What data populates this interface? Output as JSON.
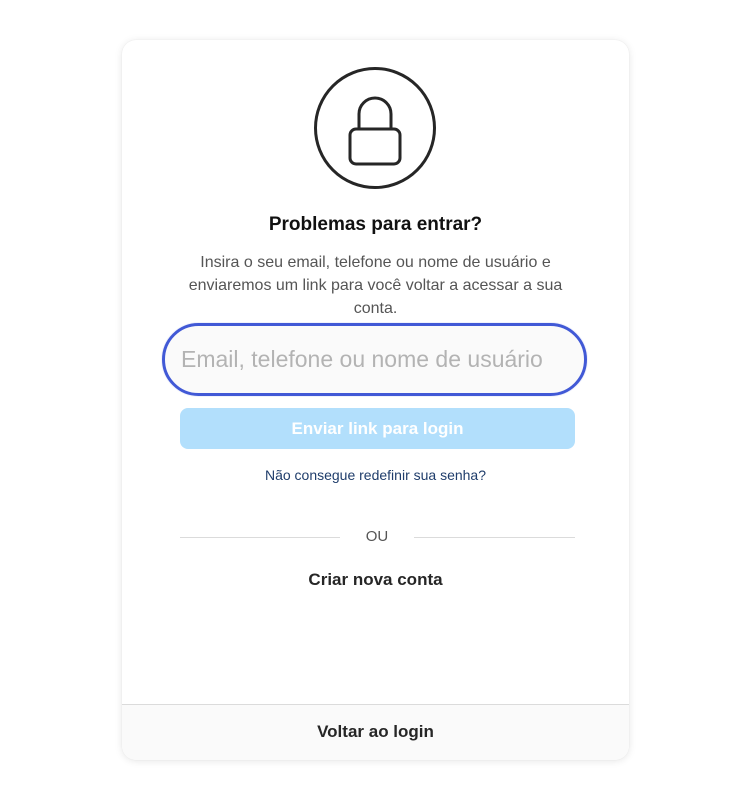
{
  "icon": "lock-icon",
  "title": "Problemas para entrar?",
  "description": "Insira o seu email, telefone ou nome de usuário e enviaremos um link para você voltar a acessar a sua conta.",
  "input": {
    "placeholder": "Email, telefone ou nome de usuário",
    "value": ""
  },
  "submit_label": "Enviar link para login",
  "help_link": "Não consegue redefinir sua senha?",
  "divider_text": "OU",
  "create_account_label": "Criar nova conta",
  "footer_label": "Voltar ao login",
  "colors": {
    "accent_focus": "#4159d6",
    "button_disabled": "#b2dffc",
    "link": "#1f3d6b"
  }
}
